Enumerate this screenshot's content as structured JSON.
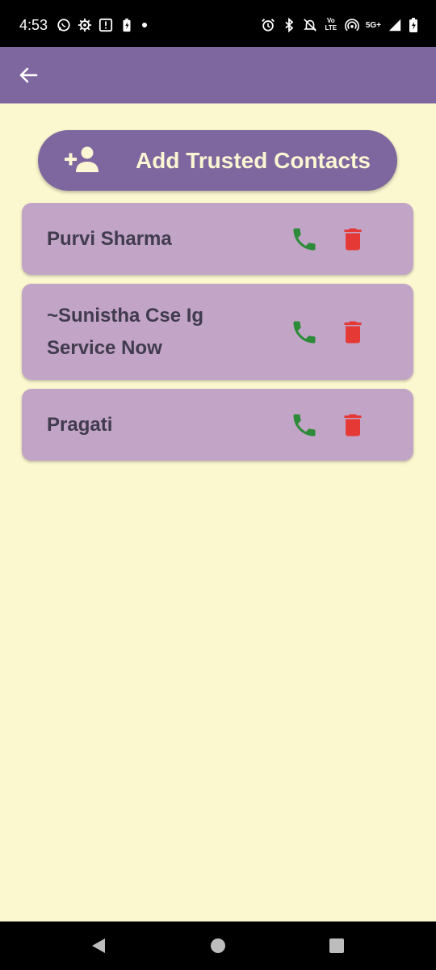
{
  "status_bar": {
    "time": "4:53",
    "left_icons": [
      "whatsapp-icon",
      "settings-gear-icon",
      "notification-box-icon",
      "battery-saver-icon",
      "dot-icon"
    ],
    "right_icons": [
      "alarm-icon",
      "bluetooth-icon",
      "do-not-disturb-icon",
      "volte-icon",
      "hotspot-icon",
      "5g-icon",
      "signal-icon",
      "battery-icon"
    ],
    "volte_line1": "Vo",
    "volte_line2": "LTE",
    "network_label": "5G+"
  },
  "app_bar": {
    "back_icon": "arrow-back-icon",
    "background_color": "#7E669E"
  },
  "add_button": {
    "label": "Add Trusted Contacts",
    "icon": "person-add-icon"
  },
  "contacts": [
    {
      "name": "Purvi Sharma"
    },
    {
      "name": "~Sunistha Cse Ig Service Now"
    },
    {
      "name": "Pragati"
    }
  ],
  "contact_actions": {
    "call_icon": "phone-icon",
    "delete_icon": "trash-icon",
    "call_color": "#2E8B3A",
    "delete_color": "#E53935"
  },
  "nav_bar": {
    "back_icon": "triangle-back-icon",
    "home_icon": "circle-home-icon",
    "recents_icon": "square-recents-icon"
  },
  "colors": {
    "page_background": "#FBF8D0",
    "card_background": "#C2A4C6",
    "accent": "#7E669E",
    "button_text": "#FBF6D3",
    "name_text": "#403B4E"
  }
}
